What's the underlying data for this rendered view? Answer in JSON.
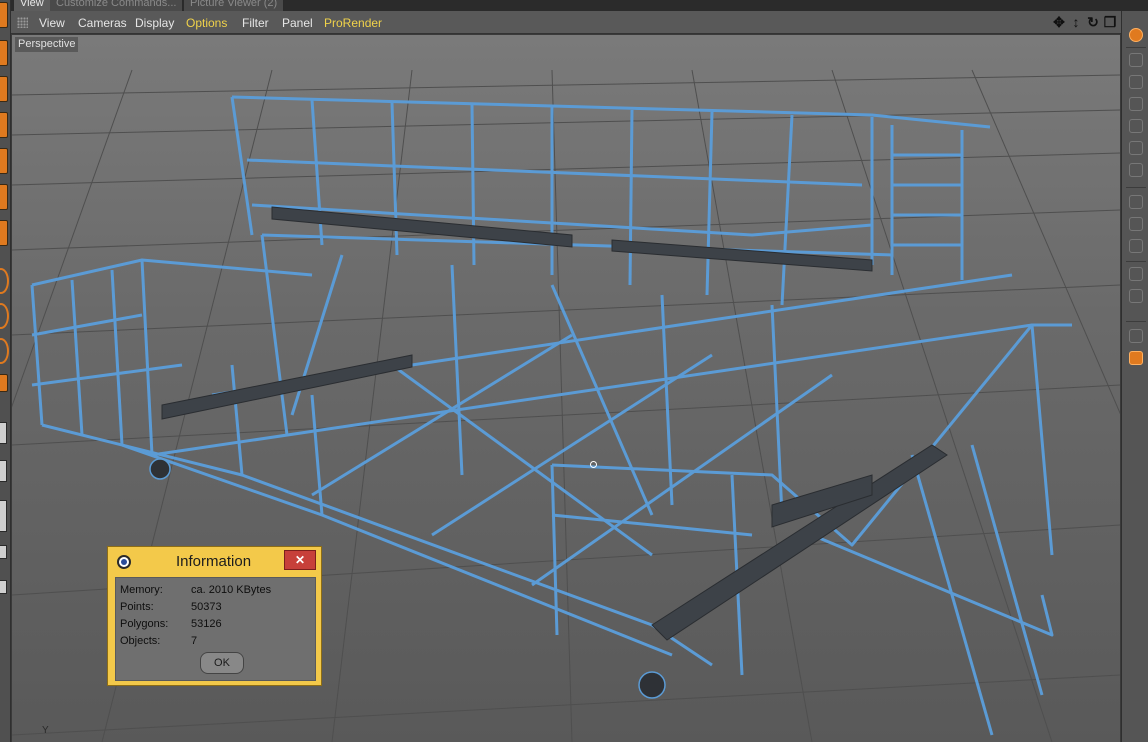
{
  "tabs": [
    {
      "label": "View",
      "active": true
    },
    {
      "label": "Customize Commands...",
      "active": false
    },
    {
      "label": "Picture Viewer (2)",
      "active": false
    }
  ],
  "menubar": {
    "items": [
      {
        "label": "View",
        "highlight": false
      },
      {
        "label": "Cameras",
        "highlight": false
      },
      {
        "label": "Display",
        "highlight": false
      },
      {
        "label": "Options",
        "highlight": true
      },
      {
        "label": "Filter",
        "highlight": false
      },
      {
        "label": "Panel",
        "highlight": false
      },
      {
        "label": "ProRender",
        "highlight": true
      }
    ],
    "nav_icons": [
      "move-view-icon",
      "pan-view-icon",
      "rotate-view-icon",
      "maximize-view-icon"
    ]
  },
  "viewport": {
    "camera_label": "Perspective",
    "axis_label": "Y",
    "wire_color": "#5b9bd5",
    "accent_color": "#e07a1f"
  },
  "info_dialog": {
    "title": "Information",
    "close_label": "✕",
    "rows": [
      {
        "key": "Memory:",
        "value": "ca. 2010 KBytes"
      },
      {
        "key": "Points:",
        "value": "50373"
      },
      {
        "key": "Polygons:",
        "value": "53126"
      },
      {
        "key": "Objects:",
        "value": "7"
      }
    ],
    "ok_label": "OK"
  }
}
